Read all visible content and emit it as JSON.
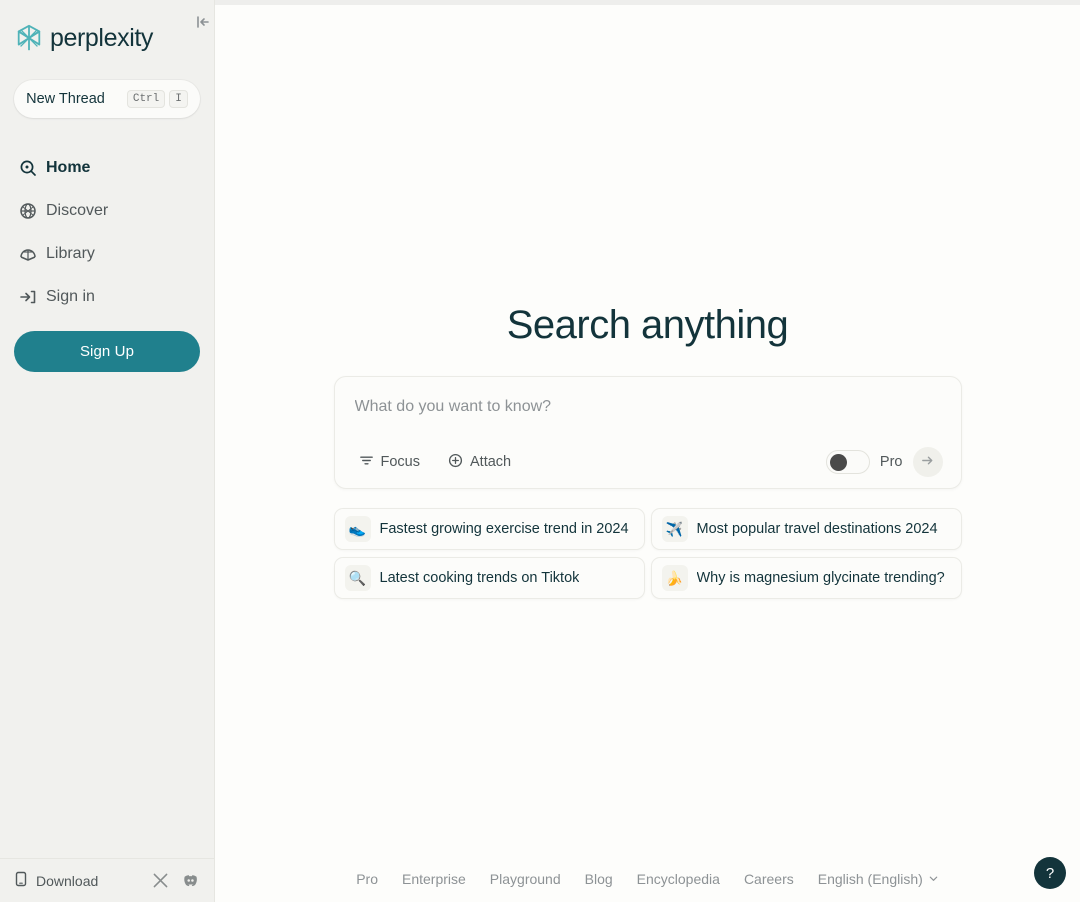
{
  "brand": {
    "name": "perplexity",
    "logo_icon": "perplexity-logo-icon",
    "logo_color": "#4FB3B8"
  },
  "sidebar": {
    "collapse_icon": "collapse-sidebar-icon",
    "new_thread": {
      "label": "New Thread",
      "shortcut_keys": [
        "Ctrl",
        "I"
      ]
    },
    "items": [
      {
        "label": "Home",
        "icon": "home-search-icon",
        "active": true
      },
      {
        "label": "Discover",
        "icon": "globe-icon",
        "active": false
      },
      {
        "label": "Library",
        "icon": "library-icon",
        "active": false
      },
      {
        "label": "Sign in",
        "icon": "sign-in-icon",
        "active": false
      }
    ],
    "signup_label": "Sign Up",
    "signup_color": "#20808D",
    "footer": {
      "download_label": "Download",
      "download_icon": "mobile-phone-icon",
      "social": [
        {
          "name": "x-twitter-icon"
        },
        {
          "name": "discord-icon"
        }
      ]
    }
  },
  "main": {
    "title": "Search anything",
    "search": {
      "placeholder": "What do you want to know?",
      "value": "",
      "focus_label": "Focus",
      "focus_icon": "focus-sliders-icon",
      "attach_label": "Attach",
      "attach_icon": "plus-circle-icon",
      "pro_label": "Pro",
      "pro_enabled": false,
      "submit_icon": "arrow-right-icon"
    },
    "suggestions": [
      {
        "emoji": "👟",
        "emoji_name": "running-shoe-emoji",
        "text": "Fastest growing exercise trend in 2024"
      },
      {
        "emoji": "✈️",
        "emoji_name": "airplane-emoji",
        "text": "Most popular travel destinations 2024"
      },
      {
        "emoji": "🔍",
        "emoji_name": "magnifying-glass-emoji",
        "text": "Latest cooking trends on Tiktok"
      },
      {
        "emoji": "🍌",
        "emoji_name": "banana-emoji",
        "text": "Why is magnesium glycinate trending?"
      }
    ]
  },
  "footer": {
    "links": [
      "Pro",
      "Enterprise",
      "Playground",
      "Blog",
      "Encyclopedia",
      "Careers"
    ],
    "language": "English (English)",
    "language_chevron_icon": "chevron-down-icon",
    "help_label": "?"
  }
}
